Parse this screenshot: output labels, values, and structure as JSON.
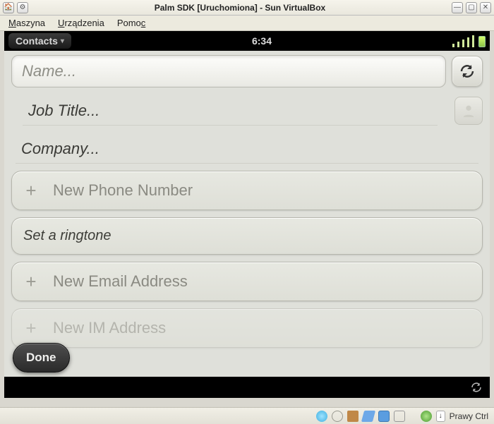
{
  "window": {
    "title": "Palm SDK [Uruchomiona] - Sun VirtualBox"
  },
  "menubar": {
    "machine": "Maszyna",
    "devices": "Urządzenia",
    "help": "Pomoc"
  },
  "status": {
    "app_name": "Contacts",
    "time": "6:34"
  },
  "form": {
    "name_placeholder": "Name...",
    "jobtitle_placeholder": "Job Title...",
    "company_placeholder": "Company...",
    "actions": {
      "new_phone": "New Phone Number",
      "ringtone": "Set a ringtone",
      "new_email": "New Email Address",
      "new_im": "New IM Address"
    },
    "done_label": "Done"
  },
  "host_status": {
    "capture_key": "Prawy Ctrl"
  },
  "icons": {
    "sync": "sync-icon",
    "contact": "contact-silhouette-icon",
    "signal": "signal-icon",
    "battery": "battery-icon"
  }
}
